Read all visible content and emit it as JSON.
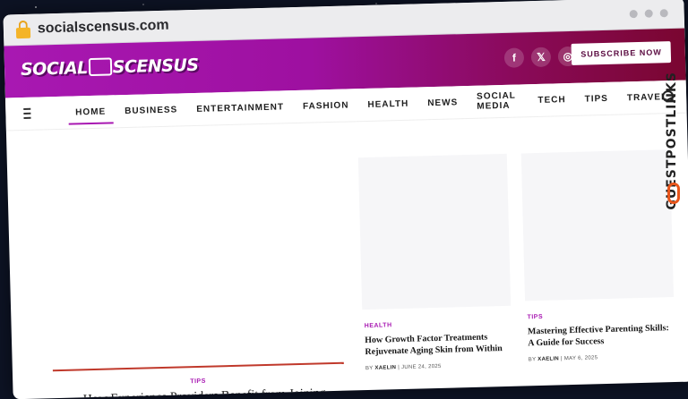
{
  "browser": {
    "url": "socialscensus.com"
  },
  "header": {
    "logo_left": "SOCIAL",
    "logo_right": "SCENSUS",
    "social": [
      {
        "icon": "facebook-icon",
        "glyph": "f"
      },
      {
        "icon": "x-icon",
        "glyph": "𝕏"
      },
      {
        "icon": "instagram-icon",
        "glyph": "◎"
      }
    ],
    "subscribe_label": "SUBSCRIBE NOW",
    "colors": {
      "gradient_start": "#a818b2",
      "gradient_end": "#7a0630"
    }
  },
  "nav": {
    "items": [
      "HOME",
      "BUSINESS",
      "ENTERTAINMENT",
      "FASHION",
      "HEALTH",
      "NEWS",
      "SOCIAL MEDIA",
      "TECH",
      "TIPS",
      "TRAVEL"
    ],
    "active": "HOME"
  },
  "hero": {
    "category": "TIPS",
    "title": "How Experience Providers Benefit from Joining"
  },
  "cards": [
    {
      "category": "HEALTH",
      "title": "How Growth Factor Treatments Rejuvenate Aging Skin from Within",
      "by": "BY",
      "author": "XAELIN",
      "date": "JUNE 24, 2025"
    },
    {
      "category": "TIPS",
      "title": "Mastering Effective Parenting Skills: A Guide for Success",
      "by": "BY",
      "author": "XAELIN",
      "date": "MAY 6, 2025"
    }
  ],
  "watermark": {
    "text": "GUESTPOSTLINKS"
  }
}
